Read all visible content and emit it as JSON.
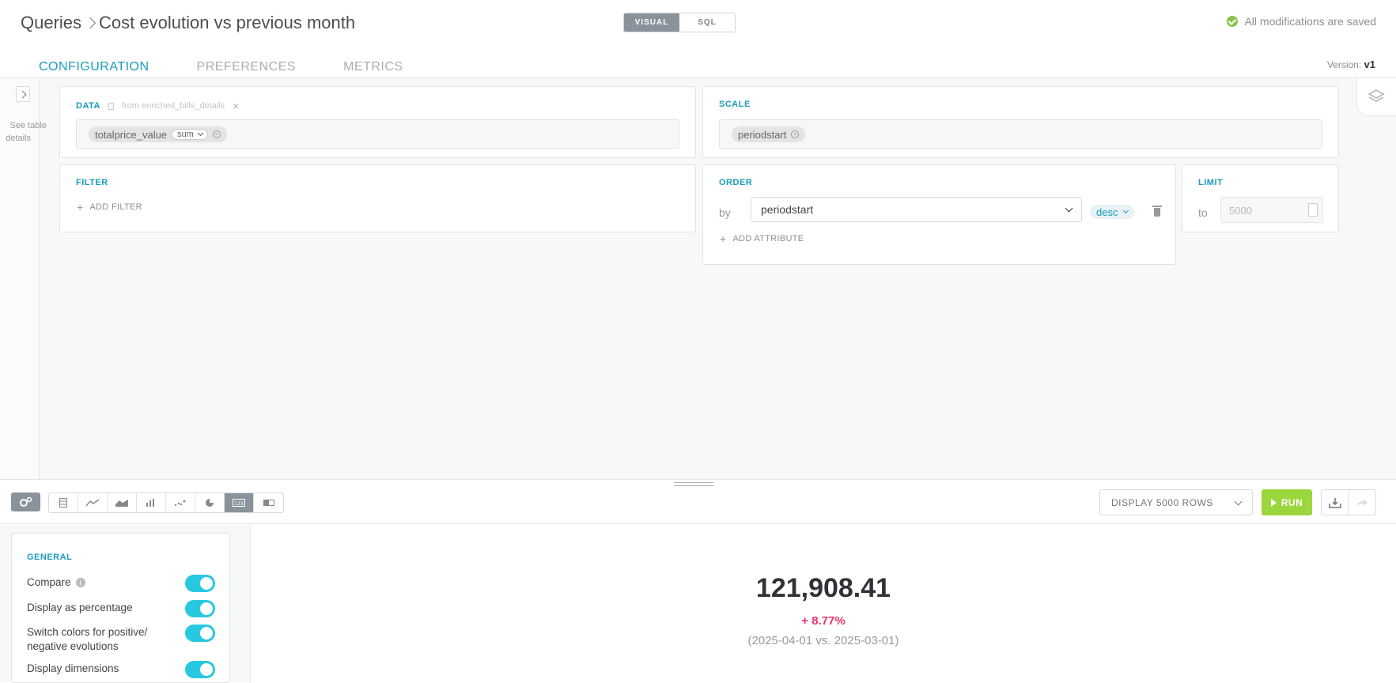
{
  "header": {
    "root": "Queries",
    "title": "Cost evolution vs previous month",
    "mode_tabs": [
      "VISUAL",
      "SQL"
    ],
    "saved_status": "All modifications are saved"
  },
  "tabs": [
    "CONFIGURATION",
    "PREFERENCES",
    "METRICS"
  ],
  "version": {
    "label": "Version:",
    "value": "v1"
  },
  "sidebar": {
    "hint_line1": "See table",
    "hint_line2": "details"
  },
  "data_card": {
    "title": "DATA",
    "source": "from enriched_bills_details",
    "measure": "totalprice_value",
    "aggregation": "sum"
  },
  "scale_card": {
    "title": "SCALE",
    "dimension": "periodstart"
  },
  "filter_card": {
    "title": "FILTER",
    "add_label": "ADD FILTER"
  },
  "order_card": {
    "title": "ORDER",
    "by_label": "by",
    "attribute": "periodstart",
    "direction": "desc",
    "add_label": "ADD ATTRIBUTE"
  },
  "limit_card": {
    "title": "LIMIT",
    "to_label": "to",
    "placeholder": "5000"
  },
  "toolbar": {
    "display_rows": "DISPLAY 5000 ROWS",
    "run_label": "RUN",
    "visualizations": [
      "table-icon",
      "line-chart-icon",
      "area-chart-icon",
      "bar-chart-icon",
      "scatter-icon",
      "pie-icon",
      "kpi-icon",
      "gauge-icon"
    ],
    "active_visualization": "kpi-icon"
  },
  "general": {
    "title": "GENERAL",
    "options": [
      {
        "label": "Compare",
        "on": true
      },
      {
        "label": "Display as percentage",
        "on": true
      },
      {
        "label_line1": "Switch colors for positive/",
        "label_line2": "negative evolutions",
        "on": true
      },
      {
        "label": "Display dimensions",
        "on": true
      }
    ]
  },
  "result": {
    "value": "121,908.41",
    "evolution": "+ 8.77%",
    "period": "(2025-04-01 vs. 2025-03-01)"
  },
  "colors": {
    "accent": "#1a9bbf",
    "run": "#9cd63d",
    "toggle": "#26c9e0",
    "negative": "#e8336d",
    "saved": "#8bc34a"
  }
}
